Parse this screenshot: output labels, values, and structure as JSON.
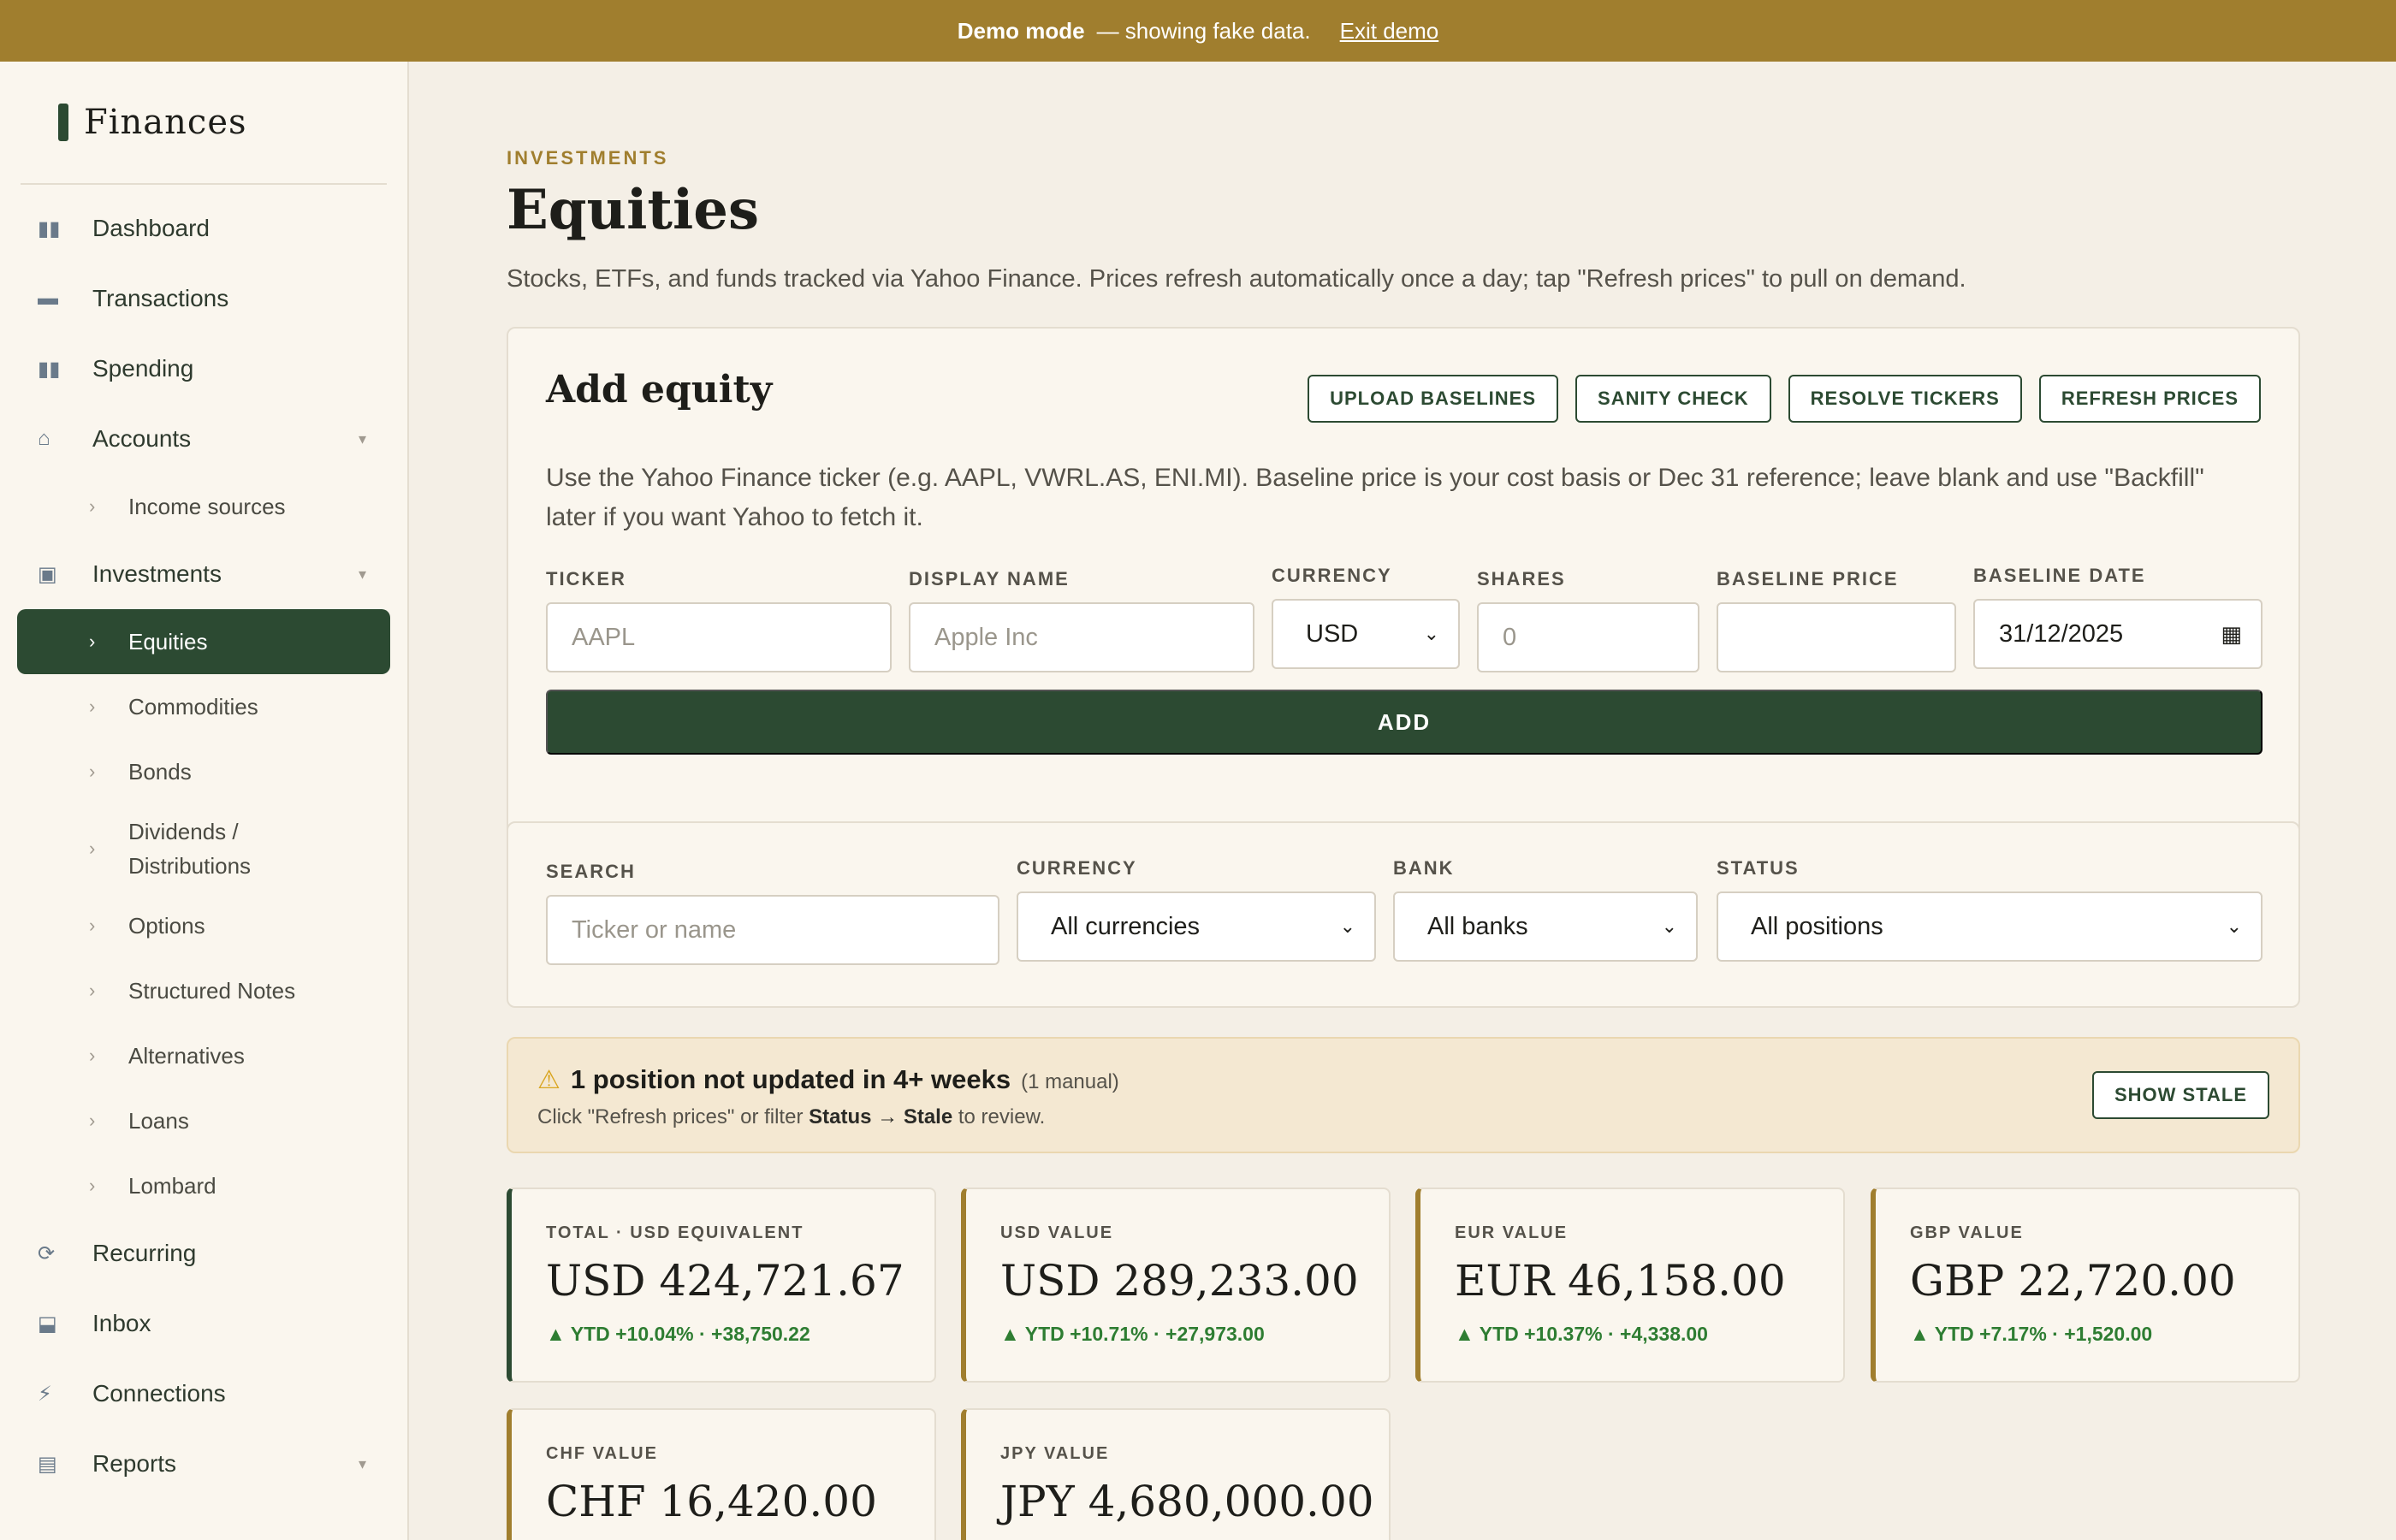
{
  "banner": {
    "mode": "Demo mode",
    "message": "— showing fake data.",
    "exit": "Exit demo"
  },
  "brand": "Finances",
  "nav": {
    "dashboard": "Dashboard",
    "transactions": "Transactions",
    "spending": "Spending",
    "accounts": "Accounts",
    "income_sources": "Income sources",
    "investments": "Investments",
    "equities": "Equities",
    "commodities": "Commodities",
    "bonds": "Bonds",
    "dividends": "Dividends / Distributions",
    "options": "Options",
    "structured_notes": "Structured Notes",
    "alternatives": "Alternatives",
    "loans": "Loans",
    "lombard": "Lombard",
    "recurring": "Recurring",
    "inbox": "Inbox",
    "connections": "Connections",
    "reports": "Reports"
  },
  "page": {
    "eyebrow": "INVESTMENTS",
    "title": "Equities",
    "subtitle": "Stocks, ETFs, and funds tracked via Yahoo Finance. Prices refresh automatically once a day; tap \"Refresh prices\" to pull on demand."
  },
  "add": {
    "title": "Add equity",
    "btn_upload": "UPLOAD BASELINES",
    "btn_sanity": "SANITY CHECK",
    "btn_resolve": "RESOLVE TICKERS",
    "btn_refresh": "REFRESH PRICES",
    "description": "Use the Yahoo Finance ticker (e.g. AAPL, VWRL.AS, ENI.MI). Baseline price is your cost basis or Dec 31 reference; leave blank and use \"Backfill\" later if you want Yahoo to fetch it.",
    "ticker_label": "TICKER",
    "ticker_placeholder": "AAPL",
    "name_label": "DISPLAY NAME",
    "name_placeholder": "Apple Inc",
    "currency_label": "CURRENCY",
    "currency_value": "USD",
    "shares_label": "SHARES",
    "shares_placeholder": "0",
    "baseline_price_label": "BASELINE PRICE",
    "baseline_price_value": "",
    "baseline_date_label": "BASELINE DATE",
    "baseline_date_value": "31/12/2025",
    "submit": "ADD"
  },
  "filters": {
    "search_label": "SEARCH",
    "search_placeholder": "Ticker or name",
    "currency_label": "CURRENCY",
    "currency_value": "All currencies",
    "bank_label": "BANK",
    "bank_value": "All banks",
    "status_label": "STATUS",
    "status_value": "All positions"
  },
  "alert": {
    "headline": "1 position not updated in 4+ weeks",
    "note": "(1 manual)",
    "sub_prefix": "Click \"Refresh prices\" or filter",
    "sub_status": "Status",
    "sub_arrow": "→",
    "sub_stale": "Stale",
    "sub_suffix": "to review.",
    "button": "SHOW STALE"
  },
  "stats": [
    {
      "label": "TOTAL · USD EQUIVALENT",
      "value": "USD 424,721.67",
      "delta": "▲ YTD +10.04% · +38,750.22"
    },
    {
      "label": "USD VALUE",
      "value": "USD 289,233.00",
      "delta": "▲ YTD +10.71% · +27,973.00"
    },
    {
      "label": "EUR VALUE",
      "value": "EUR 46,158.00",
      "delta": "▲ YTD +10.37% · +4,338.00"
    },
    {
      "label": "GBP VALUE",
      "value": "GBP 22,720.00",
      "delta": "▲ YTD +7.17% · +1,520.00"
    },
    {
      "label": "CHF VALUE",
      "value": "CHF 16,420.00",
      "delta": ""
    },
    {
      "label": "JPY VALUE",
      "value": "JPY 4,680,000.00",
      "delta": ""
    }
  ],
  "colors": {
    "banner": "#a07e2e",
    "primary": "#2c4a32",
    "accent": "#a07e2e",
    "positive": "#2e7d32",
    "background": "#f4efe6"
  }
}
